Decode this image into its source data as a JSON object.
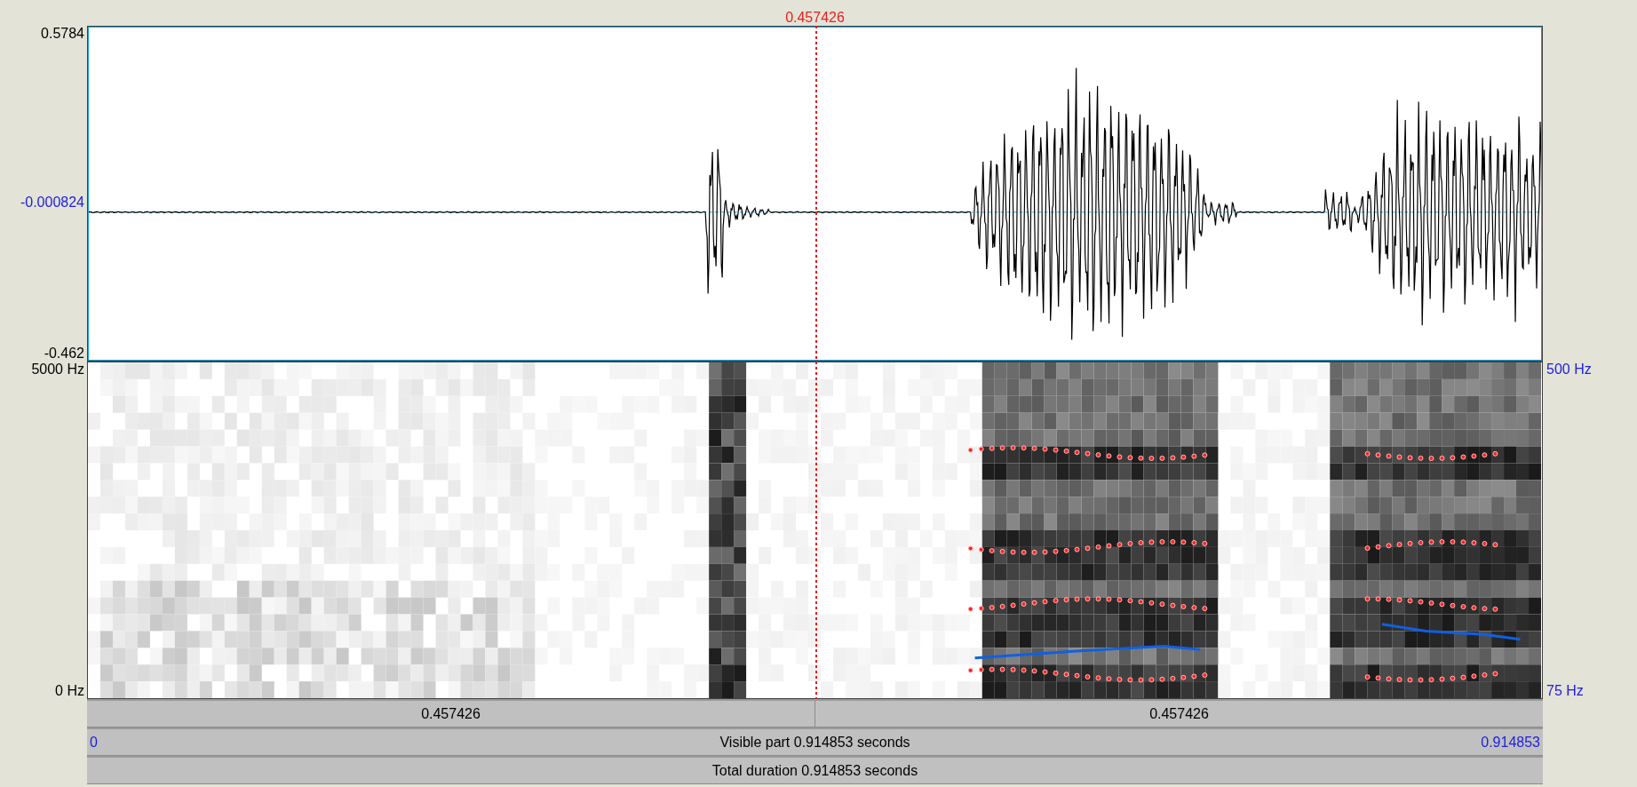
{
  "cursor": {
    "time": "0.457426"
  },
  "waveform": {
    "y_max": "0.5784",
    "y_zero": "-0.000824",
    "y_min": "-0.462"
  },
  "spectrogram": {
    "freq_max": "5000 Hz",
    "freq_min": "0 Hz",
    "pitch_max": "500 Hz",
    "pitch_min": "75 Hz"
  },
  "cursor_bar": [
    "0.457426",
    "0.457426"
  ],
  "visible_bar": {
    "start": "0",
    "label": "Visible part 0.914853 seconds",
    "end": "0.914853"
  },
  "total_bar": {
    "label": "Total duration 0.914853 seconds"
  }
}
